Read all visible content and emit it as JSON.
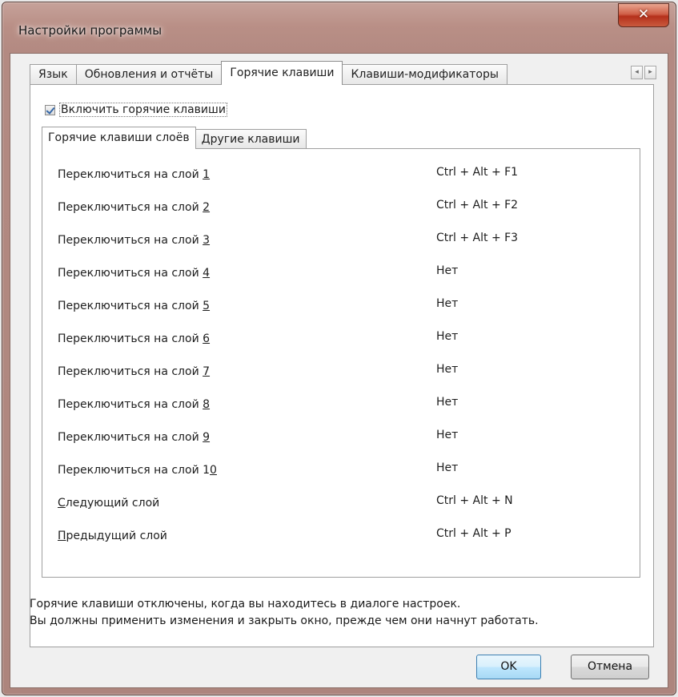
{
  "window": {
    "title": "Настройки программы",
    "close_glyph": "✕"
  },
  "tabs": [
    {
      "label": "Язык",
      "active": false
    },
    {
      "label": "Обновления и отчёты",
      "active": false
    },
    {
      "label": "Горячие клавиши",
      "active": true
    },
    {
      "label": "Клавиши-модификаторы",
      "active": false
    }
  ],
  "tab_scroll": {
    "left": "◂",
    "right": "▸"
  },
  "enable_hotkeys": {
    "label": "Включить горячие клавиши",
    "checked": true
  },
  "inner_tabs": [
    {
      "label": "Горячие клавиши слоёв",
      "active": true
    },
    {
      "label": "Другие клавиши",
      "active": false
    }
  ],
  "hotkeys": [
    {
      "prefix": "Переключиться на слой ",
      "accel": "1",
      "suffix": "",
      "key": "Ctrl + Alt + F1"
    },
    {
      "prefix": "Переключиться на слой ",
      "accel": "2",
      "suffix": "",
      "key": "Ctrl + Alt + F2"
    },
    {
      "prefix": "Переключиться на слой ",
      "accel": "3",
      "suffix": "",
      "key": "Ctrl + Alt + F3"
    },
    {
      "prefix": "Переключиться на слой ",
      "accel": "4",
      "suffix": "",
      "key": "Нет"
    },
    {
      "prefix": "Переключиться на слой ",
      "accel": "5",
      "suffix": "",
      "key": "Нет"
    },
    {
      "prefix": "Переключиться на слой ",
      "accel": "6",
      "suffix": "",
      "key": "Нет"
    },
    {
      "prefix": "Переключиться на слой ",
      "accel": "7",
      "suffix": "",
      "key": "Нет"
    },
    {
      "prefix": "Переключиться на слой ",
      "accel": "8",
      "suffix": "",
      "key": "Нет"
    },
    {
      "prefix": "Переключиться на слой ",
      "accel": "9",
      "suffix": "",
      "key": "Нет"
    },
    {
      "prefix": "Переключиться на слой 1",
      "accel": "0",
      "suffix": "",
      "key": "Нет"
    },
    {
      "prefix": "",
      "accel": "С",
      "suffix": "ледующий слой",
      "key": "Ctrl + Alt + N"
    },
    {
      "prefix": "",
      "accel": "П",
      "suffix": "редыдущий слой",
      "key": "Ctrl + Alt + P"
    }
  ],
  "note": {
    "line1": "Горячие клавиши отключены, когда вы находитесь в диалоге настроек.",
    "line2": "Вы должны применить изменения и закрыть окно, прежде чем они начнут работать."
  },
  "buttons": {
    "ok": "OK",
    "cancel": "Отмена"
  }
}
